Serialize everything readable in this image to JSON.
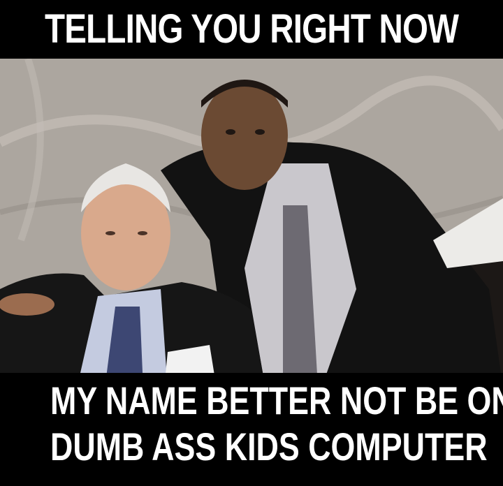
{
  "meme": {
    "top_text": "TELLING YOU RIGHT NOW",
    "bottom_text_line1": "MY NAME BETTER NOT BE ON YOUR",
    "bottom_text_line2": "DUMB ASS KIDS COMPUTER"
  },
  "colors": {
    "bar_background": "#000000",
    "caption_text": "#ffffff",
    "wall": "#b0aaa4",
    "suit": "#141414"
  }
}
